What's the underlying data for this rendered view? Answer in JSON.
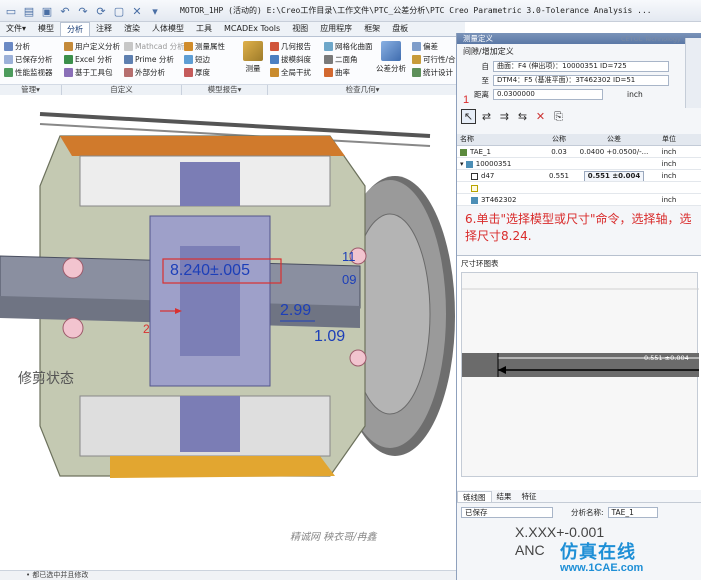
{
  "window": {
    "title": "MOTOR_1HP (活动的) E:\\Creo工作目录\\工作文件\\PTC_公差分析\\PTC  Creo Parametric 3.0-Tolerance Analysis ..."
  },
  "menu_tabs": [
    "文件▾",
    "模型",
    "分析",
    "注释",
    "渲染",
    "人体模型",
    "工具",
    "MCADEx Tools",
    "视图",
    "应用程序",
    "框架",
    "盘板"
  ],
  "ribbon": {
    "col1": [
      "分析",
      "已保存分析",
      "性能监视器"
    ],
    "col2": [
      "用户定义分析",
      "Excel 分析",
      "基于工具包"
    ],
    "col3": [
      "Mathcad 分析",
      "Prime 分析",
      "外部分析"
    ],
    "col4": [
      "测量属性",
      "短边",
      "厚度"
    ],
    "measure": "测量",
    "col5": [
      "几何报告",
      "拔模斜度",
      "全局干扰"
    ],
    "col6": [
      "网格化曲面",
      "二面角",
      "曲率"
    ],
    "tolerance": "公差分析",
    "col7": [
      "偏差",
      "可行性/合",
      "统计设计"
    ],
    "groups": [
      "管理▾",
      "自定义",
      "模型报告▾",
      "检查几何▾"
    ]
  },
  "viewport": {
    "dims": {
      "d1": "8.240±.005",
      "d2": "11",
      "d3": "09",
      "d4": "2.99",
      "d5": "1.09",
      "d6": "2"
    },
    "trim_label": "修剪状态",
    "bottom_watermark": "精诚网  秧衣哥/冉鑫",
    "status": "• 都已选中并且修改"
  },
  "dialog": {
    "title": "测量定义",
    "tech": "CETOL Technology ⓘ",
    "section": "间隙/增加定义",
    "from_label": "自",
    "from_value": "曲面：F4 (伸出项)：10000351  ID=725",
    "to_label": "至",
    "to_value": "DTM4：F5 (基准平面)：3T462302  ID=51",
    "dist_label": "距离",
    "dist_value": "0.0300000",
    "dist_unit": "inch",
    "step1": "1",
    "toolbar": [
      "↖",
      "⇄",
      "⇉",
      "⇆",
      "✕",
      "⎘"
    ],
    "table": {
      "headers": [
        "名称",
        "公称",
        "公差",
        "单位"
      ],
      "rows": [
        {
          "name": "TAE_1",
          "nominal": "0.03",
          "tol": "0.0400 +0.0500/-...",
          "unit": "inch"
        },
        {
          "name": "10000351",
          "nominal": "",
          "tol": "",
          "unit": "inch"
        },
        {
          "name": "d47",
          "nominal": "0.551",
          "tol": "0.551 ±0.004",
          "unit": "inch"
        },
        {
          "name": "",
          "nominal": "",
          "tol": "",
          "unit": ""
        },
        {
          "name": "3T462302",
          "nominal": "",
          "tol": "",
          "unit": "inch"
        }
      ]
    },
    "step6": "6.单击\"选择模型或尺寸\"命令，选择轴，选择尺寸8.24.",
    "chain_title": "尺寸环图表",
    "chain_value": "0.551 ±0.004",
    "bottom_tabs": [
      "链线图",
      "结果",
      "特征"
    ],
    "footer_select": "已保存",
    "footer_label": "分析名称:",
    "footer_value": "TAE_1"
  },
  "overlay": {
    "xxx": "X.XXX+-0.001",
    "anc": "ANC",
    "brand": "仿真在线",
    "brand_url": "www.1CAE.com"
  }
}
